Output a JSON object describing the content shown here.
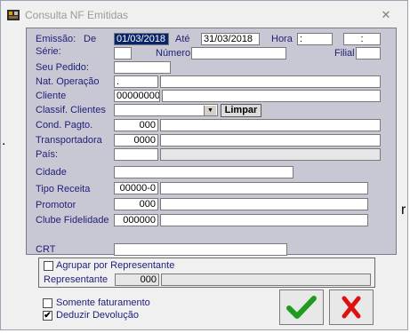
{
  "window": {
    "title": "Consulta NF Emitidas",
    "close_glyph": "✕"
  },
  "labels": {
    "emissao": "Emissão:",
    "de": "De",
    "ate": "Até",
    "hora": "Hora",
    "serie": "Série:",
    "numero": "Número",
    "filial": "Filial",
    "seu_pedido": "Seu Pedido:",
    "nat_operacao": "Nat. Operação",
    "cliente": "Cliente",
    "classif_clientes": "Classif. Clientes",
    "cond_pagto": "Cond. Pagto.",
    "transportadora": "Transportadora",
    "pais": "País:",
    "cidade": "Cidade",
    "tipo_receita": "Tipo Receita",
    "promotor": "Promotor",
    "clube_fidelidade": "Clube Fidelidade",
    "crt": "CRT",
    "representante": "Representante"
  },
  "fields": {
    "data_de": "01/03/2018",
    "data_ate": "31/03/2018",
    "hora_de": ":",
    "hora_ate": ":",
    "nat_operacao": ".",
    "cliente": "00000000",
    "cond_pagto": "000",
    "transportadora": "0000",
    "tipo_receita": "00000-0",
    "promotor": "000",
    "clube_fidelidade": "000000",
    "representante": "000"
  },
  "buttons": {
    "limpar": "Limpar"
  },
  "checkboxes": {
    "agrupar_por_representante": {
      "label": "Agrupar por Representante",
      "checked": false
    },
    "somente_faturamento": {
      "label": "Somente faturamento",
      "checked": false
    },
    "deduzir_devolucao": {
      "label": "Deduzir Devolução",
      "checked": true
    }
  },
  "glyphs": {
    "check": "✔",
    "combo": "▼",
    "side_mark": "r"
  },
  "colors": {
    "ok": "#1f9b1f",
    "cancel": "#e01010",
    "label": "#1e1e78"
  }
}
